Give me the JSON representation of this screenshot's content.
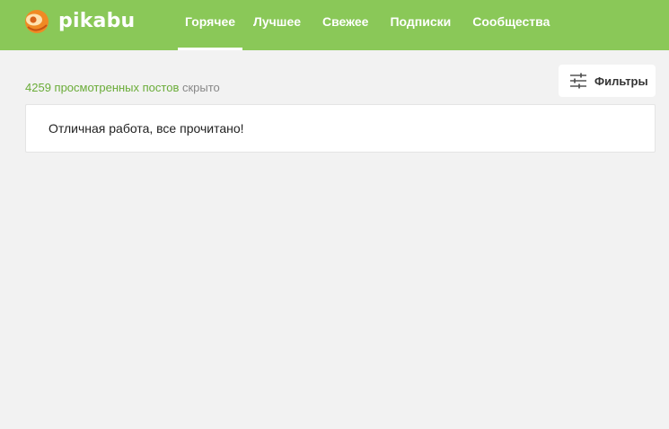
{
  "header": {
    "logo_text": "pikabu",
    "nav": [
      {
        "label": "Горячее",
        "active": true
      },
      {
        "label": "Лучшее",
        "active": false
      },
      {
        "label": "Свежее",
        "active": false
      },
      {
        "label": "Подписки",
        "active": false
      },
      {
        "label": "Сообщества",
        "active": false
      }
    ]
  },
  "toolbar": {
    "viewed_count_link": "4259 просмотренных постов",
    "hidden_suffix": " скрыто",
    "filters_label": "Фильтры"
  },
  "feed": {
    "empty_message": "Отличная работа, все прочитано!"
  },
  "icons": {
    "logo": "pikabu-logo-icon",
    "filters": "sliders-icon"
  },
  "colors": {
    "header_bg": "#8ac858",
    "accent_link": "#6aac38",
    "page_bg": "#f2f2f2"
  }
}
